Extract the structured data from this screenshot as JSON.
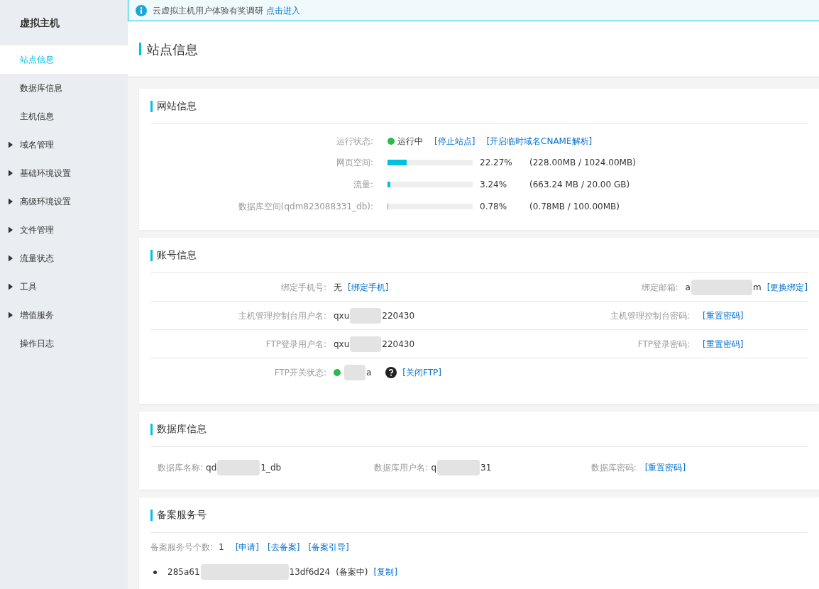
{
  "sidebar": {
    "title": "虚拟主机",
    "items": [
      {
        "label": "站点信息",
        "selected": true,
        "kind": "link"
      },
      {
        "label": "数据库信息",
        "selected": false,
        "kind": "link"
      },
      {
        "label": "主机信息",
        "selected": false,
        "kind": "link"
      },
      {
        "label": "域名管理",
        "selected": false,
        "kind": "group"
      },
      {
        "label": "基础环境设置",
        "selected": false,
        "kind": "group"
      },
      {
        "label": "高级环境设置",
        "selected": false,
        "kind": "group"
      },
      {
        "label": "文件管理",
        "selected": false,
        "kind": "group"
      },
      {
        "label": "流量状态",
        "selected": false,
        "kind": "group"
      },
      {
        "label": "工具",
        "selected": false,
        "kind": "group"
      },
      {
        "label": "增值服务",
        "selected": false,
        "kind": "group"
      },
      {
        "label": "操作日志",
        "selected": false,
        "kind": "link"
      }
    ]
  },
  "notice": {
    "text": "云虚拟主机用户体验有奖调研",
    "link": "点击进入"
  },
  "page_title": "站点信息",
  "site_info": {
    "title": "网站信息",
    "status": {
      "label": "运行状态:",
      "value": "运行中",
      "color": "#2db84d",
      "links": [
        "[停止站点]",
        "[开启临时域名CNAME解析]"
      ]
    },
    "usage": [
      {
        "label": "网页空间:",
        "level": 0.2227,
        "percent": "22.27%",
        "detail": "(228.00MB / 1024.00MB)"
      },
      {
        "label": "流量:",
        "level": 0.0324,
        "percent": "3.24%",
        "detail": "(663.24 MB / 20.00 GB)"
      },
      {
        "label": "数据库空间(qdm823088331_db):",
        "level": 0.0078,
        "percent": "0.78%",
        "detail": "(0.78MB / 100.00MB)"
      }
    ]
  },
  "account": {
    "title": "账号信息",
    "rows": [
      {
        "left": {
          "label": "绑定手机号:",
          "value_head": "无",
          "links": [
            "[绑定手机]"
          ]
        },
        "right": {
          "label": "绑定邮箱:",
          "value_head": "a",
          "value_tail": "m",
          "redacted": true,
          "links": [
            "[更换绑定]"
          ]
        }
      },
      {
        "left": {
          "label": "主机管理控制台用户名:",
          "value_head": "qxu",
          "value_tail": "220430",
          "redacted": true
        },
        "right": {
          "label": "主机管理控制台密码:",
          "links": [
            "[重置密码]"
          ]
        }
      },
      {
        "left": {
          "label": "FTP登录用户名:",
          "value_head": "qxu",
          "value_tail": "220430",
          "redacted": true
        },
        "right": {
          "label": "FTP登录密码:",
          "links": [
            "[重置密码]"
          ]
        }
      },
      {
        "left": {
          "label": "FTP开关状态:",
          "color": "#2db84d",
          "value_tail": "a",
          "redacted": true,
          "help": true,
          "links": [
            "[关闭FTP]"
          ]
        }
      }
    ]
  },
  "database": {
    "title": "数据库信息",
    "fields": [
      {
        "label": "数据库名称:",
        "value_head": "qd",
        "value_tail": "1_db",
        "redacted": true
      },
      {
        "label": "数据库用户名:",
        "value_head": "q",
        "value_tail": "31",
        "redacted": true
      },
      {
        "label": "数据库密码:",
        "links": [
          "[重置密码]"
        ]
      }
    ]
  },
  "filing": {
    "title": "备案服务号",
    "count_label": "备案服务号个数:",
    "count": "1",
    "links": [
      "[申请]",
      "[去备案]",
      "[备案引导]"
    ],
    "items": [
      {
        "value_head": "285a61",
        "value_tail": "13df6d24",
        "redacted": true,
        "status": "(备案中)",
        "links": [
          "[复制]"
        ]
      }
    ]
  }
}
